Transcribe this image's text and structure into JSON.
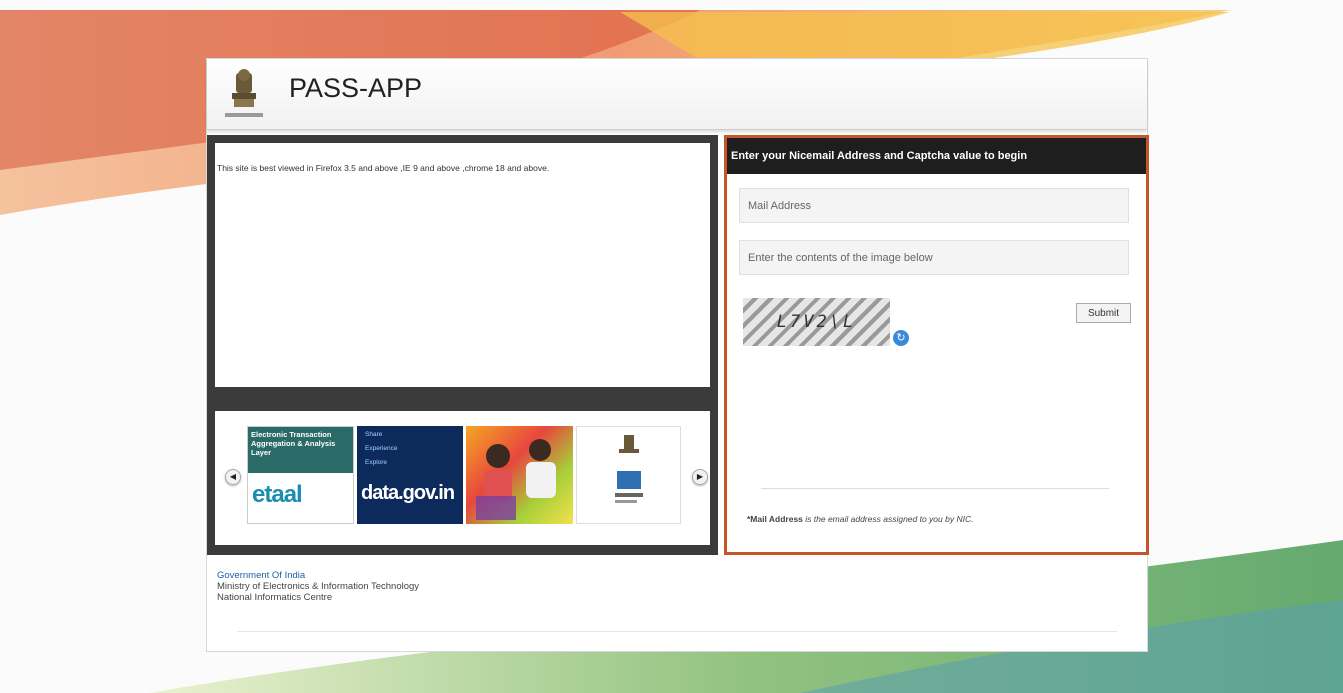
{
  "app": {
    "title": "PASS-APP"
  },
  "notice": {
    "text": "This site is best viewed in Firefox 3.5 and above ,IE 9 and above ,chrome 18 and above."
  },
  "carousel": {
    "prev": "◀",
    "next": "▶",
    "slides": [
      {
        "name": "etool",
        "heading": "Electronic Transaction Aggregation & Analysis Layer",
        "logo": "etaal"
      },
      {
        "name": "data-gov",
        "items": [
          "Share",
          "Experience",
          "Explore"
        ],
        "logo": "data.gov.in"
      },
      {
        "name": "photo-banner"
      },
      {
        "name": "emblem-banner"
      }
    ]
  },
  "form": {
    "heading": "Enter your Nicemail Address and Captcha value to begin",
    "mail_placeholder": "Mail Address",
    "captcha_placeholder": "Enter the contents of the image below",
    "captcha_text": "L7V2\\L",
    "submit_label": "Submit",
    "note_bold": "*Mail Address",
    "note_rest": " is the email address assigned to you by NIC."
  },
  "footer": {
    "org": "Government Of India",
    "ministry": "Ministry of Electronics & Information Technology",
    "centre": "National Informatics Centre"
  },
  "colors": {
    "accent": "#c5562b",
    "form_header": "#1e1e1e",
    "panel_dark": "#3b3b3b",
    "link": "#1f5fa8"
  }
}
